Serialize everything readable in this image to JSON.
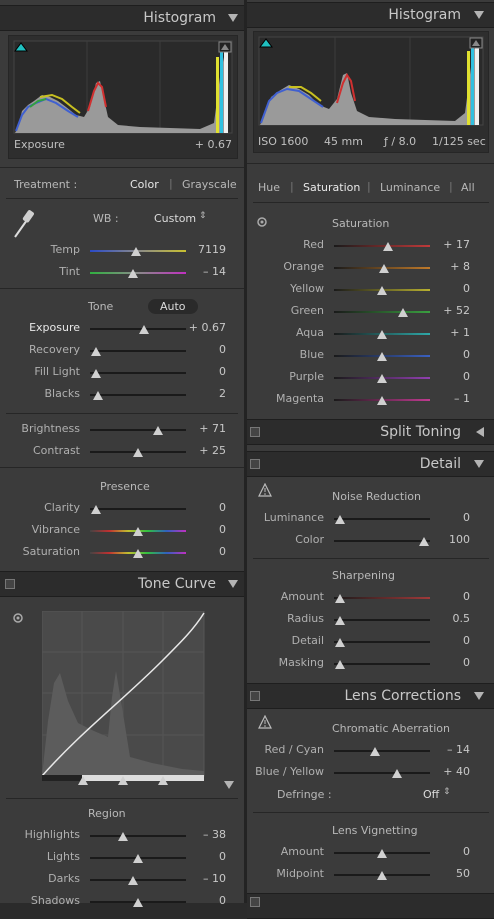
{
  "left": {
    "histogram": {
      "title": "Histogram",
      "footer_label": "Exposure",
      "footer_value": "+ 0.67"
    },
    "treatment": {
      "label": "Treatment :",
      "color": "Color",
      "grayscale": "Grayscale"
    },
    "wb": {
      "label": "WB :",
      "value": "Custom"
    },
    "sliders_wb": [
      {
        "label": "Temp",
        "value": "7119",
        "pos": 0.48,
        "track": "temp"
      },
      {
        "label": "Tint",
        "value": "– 14",
        "pos": 0.45,
        "track": "tint"
      }
    ],
    "tone": {
      "label": "Tone",
      "auto": "Auto"
    },
    "sliders_tone": [
      {
        "label": "Exposure",
        "value": "+ 0.67",
        "pos": 0.56
      },
      {
        "label": "Recovery",
        "value": "0",
        "pos": 0.06
      },
      {
        "label": "Fill Light",
        "value": "0",
        "pos": 0.06
      },
      {
        "label": "Blacks",
        "value": "2",
        "pos": 0.08
      },
      {
        "label": "Brightness",
        "value": "+ 71",
        "pos": 0.71
      },
      {
        "label": "Contrast",
        "value": "+ 25",
        "pos": 0.5
      }
    ],
    "presence": {
      "label": "Presence"
    },
    "sliders_presence": [
      {
        "label": "Clarity",
        "value": "0",
        "pos": 0.06,
        "track": "plain"
      },
      {
        "label": "Vibrance",
        "value": "0",
        "pos": 0.5,
        "track": "rainbow"
      },
      {
        "label": "Saturation",
        "value": "0",
        "pos": 0.5,
        "track": "rainbow"
      }
    ],
    "tone_curve": {
      "title": "Tone Curve",
      "region": "Region"
    },
    "sliders_region": [
      {
        "label": "Highlights",
        "value": "– 38",
        "pos": 0.34
      },
      {
        "label": "Lights",
        "value": "0",
        "pos": 0.5
      },
      {
        "label": "Darks",
        "value": "– 10",
        "pos": 0.45
      },
      {
        "label": "Shadows",
        "value": "0",
        "pos": 0.5
      }
    ]
  },
  "right": {
    "histogram": {
      "title": "Histogram",
      "iso": "ISO 1600",
      "focal": "45 mm",
      "aperture": "ƒ / 8.0",
      "shutter": "1/125 sec"
    },
    "hsl_tabs": [
      "Hue",
      "Saturation",
      "Luminance",
      "All"
    ],
    "saturation_title": "Saturation",
    "sliders_saturation": [
      {
        "label": "Red",
        "value": "+ 17",
        "pos": 0.56,
        "color": "#c03a3a"
      },
      {
        "label": "Orange",
        "value": "+ 8",
        "pos": 0.52,
        "color": "#c07a2a"
      },
      {
        "label": "Yellow",
        "value": "0",
        "pos": 0.5,
        "color": "#b8b030"
      },
      {
        "label": "Green",
        "value": "+ 52",
        "pos": 0.72,
        "color": "#3aa040"
      },
      {
        "label": "Aqua",
        "value": "+ 1",
        "pos": 0.5,
        "color": "#2ea8a8"
      },
      {
        "label": "Blue",
        "value": "0",
        "pos": 0.5,
        "color": "#3a60c0"
      },
      {
        "label": "Purple",
        "value": "0",
        "pos": 0.5,
        "color": "#9040b0"
      },
      {
        "label": "Magenta",
        "value": "– 1",
        "pos": 0.5,
        "color": "#c03a90"
      }
    ],
    "split_toning": "Split Toning",
    "detail": {
      "title": "Detail",
      "noise": "Noise Reduction",
      "sharpening": "Sharpening"
    },
    "sliders_noise": [
      {
        "label": "Luminance",
        "value": "0",
        "pos": 0.06
      },
      {
        "label": "Color",
        "value": "100",
        "pos": 0.94
      }
    ],
    "sliders_sharpen": [
      {
        "label": "Amount",
        "value": "0",
        "pos": 0.06,
        "color": "#a03a3a"
      },
      {
        "label": "Radius",
        "value": "0.5",
        "pos": 0.06
      },
      {
        "label": "Detail",
        "value": "0",
        "pos": 0.06
      },
      {
        "label": "Masking",
        "value": "0",
        "pos": 0.06
      }
    ],
    "lens": {
      "title": "Lens Corrections",
      "ca": "Chromatic Aberration",
      "vignetting": "Lens Vignetting",
      "defringe_label": "Defringe :",
      "defringe_value": "Off"
    },
    "sliders_ca": [
      {
        "label": "Red / Cyan",
        "value": "– 14",
        "pos": 0.43
      },
      {
        "label": "Blue / Yellow",
        "value": "+ 40",
        "pos": 0.66
      }
    ],
    "sliders_vignette": [
      {
        "label": "Amount",
        "value": "0",
        "pos": 0.5
      },
      {
        "label": "Midpoint",
        "value": "50",
        "pos": 0.5
      }
    ]
  }
}
